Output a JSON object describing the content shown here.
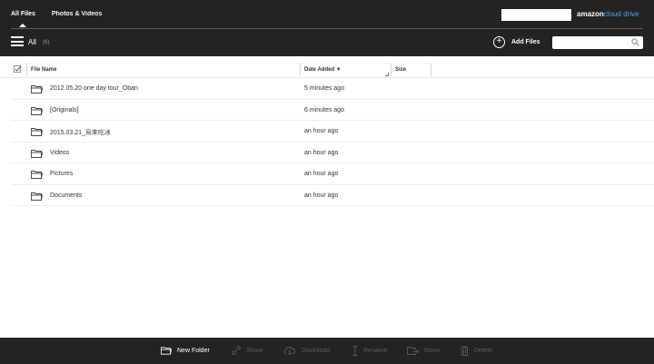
{
  "header": {
    "tabs": [
      {
        "label": "All Files",
        "active": true
      },
      {
        "label": "Photos & Videos",
        "active": false
      }
    ],
    "brand": {
      "prefix": "amazon",
      "suffix": "cloud drive"
    },
    "menu_icon": "hamburger-icon",
    "view_label": "All",
    "count": "(6)",
    "add_files_label": "Add Files",
    "search_placeholder": ""
  },
  "columns": {
    "file_name": "File Name",
    "date_added": "Date Added",
    "size": "Size"
  },
  "files": [
    {
      "name": "2012.05.20 one day tour_Oban",
      "date": "5 minutes ago",
      "icon": "folder-icon"
    },
    {
      "name": "[Originals]",
      "date": "6 minutes ago",
      "icon": "folder-icon"
    },
    {
      "name": "2015.03.21_烏來吃冰",
      "date": "an hour ago",
      "icon": "folder-icon"
    },
    {
      "name": "Videos",
      "date": "an hour ago",
      "icon": "folder-icon"
    },
    {
      "name": "Pictures",
      "date": "an hour ago",
      "icon": "folder-icon"
    },
    {
      "name": "Documents",
      "date": "an hour ago",
      "icon": "folder-icon"
    }
  ],
  "toolbar": {
    "new_folder": "New Folder",
    "share": "Share",
    "download": "Download",
    "rename": "Rename",
    "move": "Move",
    "delete": "Delete"
  },
  "colors": {
    "bar_bg": "#232323",
    "brand_accent": "#4aa6e6",
    "disabled": "#5a5a5a"
  }
}
